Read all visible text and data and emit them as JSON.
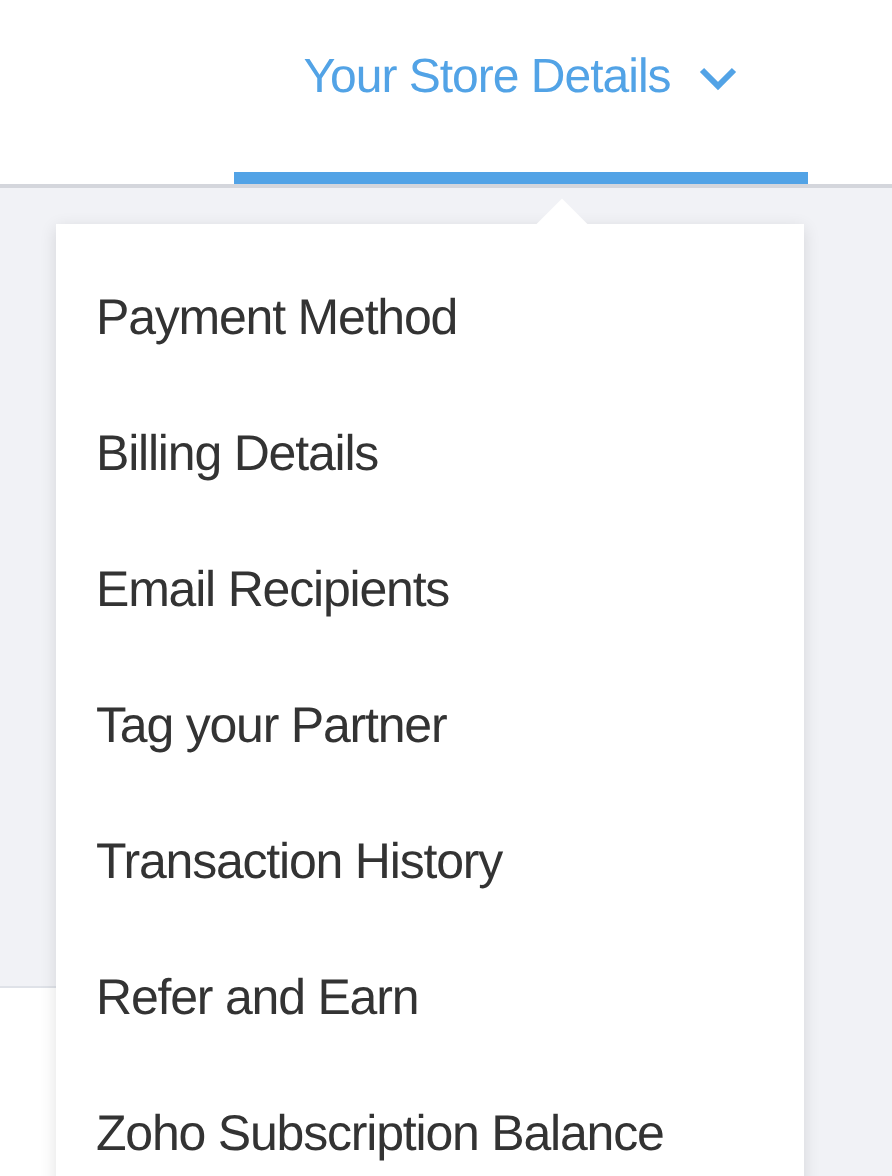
{
  "tabs": [
    {
      "label": "Your Store Details",
      "selected": true,
      "expanded": true
    }
  ],
  "dropdown": {
    "items": [
      {
        "label": "Payment Method"
      },
      {
        "label": "Billing Details"
      },
      {
        "label": "Email Recipients"
      },
      {
        "label": "Tag your Partner"
      },
      {
        "label": "Transaction History"
      },
      {
        "label": "Refer and Earn"
      },
      {
        "label": "Zoho Subscription Balance"
      }
    ]
  }
}
